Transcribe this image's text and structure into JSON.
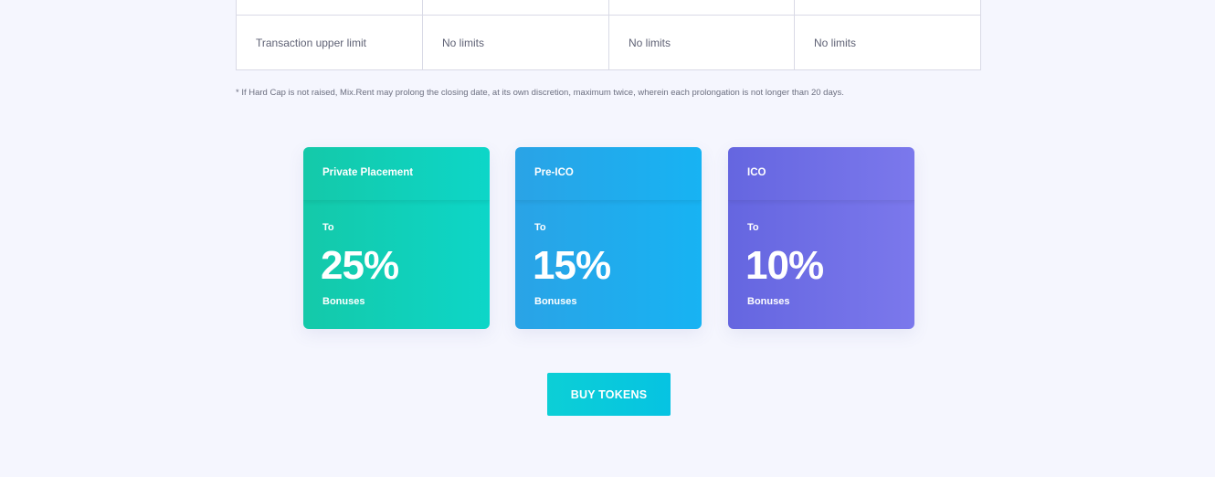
{
  "table": {
    "rows": [
      {
        "label": "",
        "cells": [
          "",
          "",
          ""
        ]
      },
      {
        "label": "Transaction upper limit",
        "cells": [
          "No limits",
          "No limits",
          "No limits"
        ]
      }
    ]
  },
  "footnote": "* If Hard Cap is not raised, Mix.Rent may prolong the closing date, at its own discretion, maximum twice, wherein each prolongation is not longer than 20 days.",
  "cards": [
    {
      "title": "Private Placement",
      "prefix": "To",
      "value": "25%",
      "suffix": "Bonuses",
      "color": "#14c9a9"
    },
    {
      "title": "Pre-ICO",
      "prefix": "To",
      "value": "15%",
      "suffix": "Bonuses",
      "color": "#2aa3e6"
    },
    {
      "title": "ICO",
      "prefix": "To",
      "value": "10%",
      "suffix": "Bonuses",
      "color": "#6566e0"
    }
  ],
  "buy_button": {
    "label": "BUY TOKENS",
    "color": "#0ccfd6"
  }
}
